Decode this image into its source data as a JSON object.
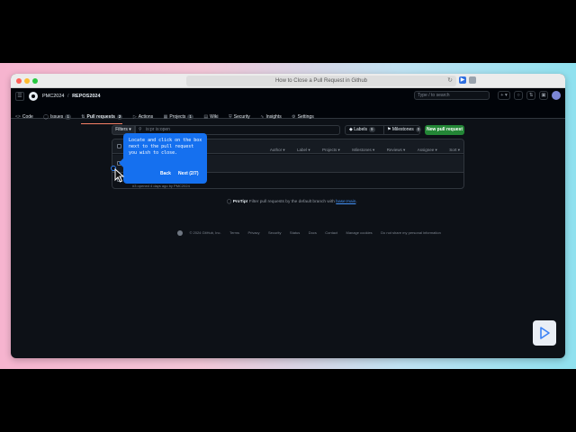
{
  "browser": {
    "address_text": "How to Close a Pull Request in Github"
  },
  "header": {
    "org": "PMC2024",
    "repo": "REPOS2024",
    "search_placeholder": "Type / to search"
  },
  "tabs": [
    {
      "label": "Code",
      "icon": "code-icon",
      "count": ""
    },
    {
      "label": "Issues",
      "icon": "issue-icon",
      "count": "1"
    },
    {
      "label": "Pull requests",
      "icon": "pull-request-icon",
      "count": "2"
    },
    {
      "label": "Actions",
      "icon": "play-icon",
      "count": ""
    },
    {
      "label": "Projects",
      "icon": "table-icon",
      "count": "1"
    },
    {
      "label": "Wiki",
      "icon": "book-icon",
      "count": ""
    },
    {
      "label": "Security",
      "icon": "shield-icon",
      "count": ""
    },
    {
      "label": "Insights",
      "icon": "graph-icon",
      "count": ""
    },
    {
      "label": "Settings",
      "icon": "gear-icon",
      "count": ""
    }
  ],
  "filterbar": {
    "filters_label": "Filters",
    "filter_placeholder": "is:pr is:open",
    "labels_label": "Labels",
    "labels_count": "9",
    "milestones_label": "Milestones",
    "milestones_count": "0",
    "new_pr_label": "New pull request"
  },
  "pr_list": {
    "sort_columns": [
      "Author",
      "Label",
      "Projects",
      "Milestones",
      "Reviews",
      "Assignee",
      "Sort"
    ],
    "second_row_meta": "#3 opened 4 days ago by PMC2024"
  },
  "tooltip": {
    "text": "Locate and click on the box next to the pull request you wish to close.",
    "back_label": "Back",
    "next_label": "Next (2/7)"
  },
  "protip": {
    "prefix": "ProTip!",
    "body": " Filter pull requests by the default branch with ",
    "link": "base:main",
    "suffix": "."
  },
  "footer": {
    "links": [
      "© 2024 GitHub, Inc.",
      "Terms",
      "Privacy",
      "Security",
      "Status",
      "Docs",
      "Contact",
      "Manage cookies",
      "Do not share my personal information"
    ]
  },
  "colors": {
    "accent_blue": "#1570ef",
    "new_pr_green": "#238636",
    "tab_underline": "#f78166",
    "page_bg": "#0d1117"
  }
}
